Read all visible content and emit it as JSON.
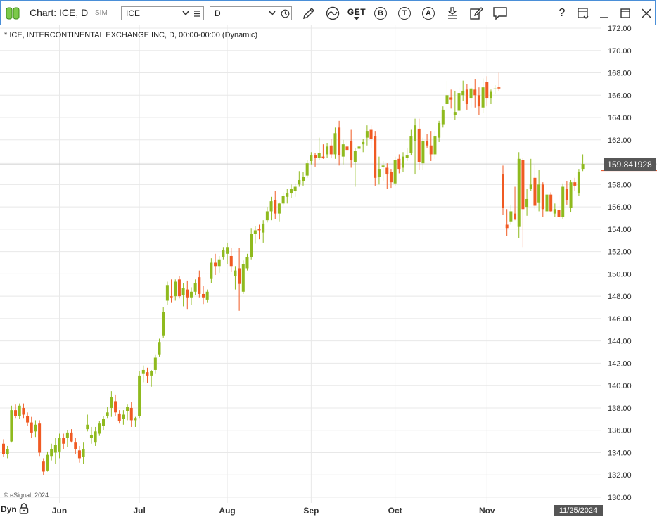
{
  "window": {
    "title": "Chart: ICE, D",
    "mode": "SIM",
    "symbol_value": "ICE",
    "interval_value": "D"
  },
  "toolbar": {
    "get_label": "GET",
    "b_label": "B",
    "t_label": "T",
    "a_label": "A",
    "help_label": "?"
  },
  "legend_text": "* ICE, INTERCONTINENTAL EXCHANGE INC, D, 00:00-00:00 (Dynamic)",
  "credit": "© eSignal, 2024",
  "dyn_label": "Dyn",
  "last_price": "159.841928",
  "current_date": "11/25/2024",
  "colors": {
    "up": "#8fba1e",
    "down": "#f05a23",
    "price_line": "#e65c35",
    "grid": "#e8e8e8"
  },
  "chart_data": {
    "type": "candlestick",
    "title": "",
    "ylim": [
      130,
      172
    ],
    "y_ticks": [
      "130.00",
      "132.00",
      "134.00",
      "136.00",
      "138.00",
      "140.00",
      "142.00",
      "144.00",
      "146.00",
      "148.00",
      "150.00",
      "152.00",
      "154.00",
      "156.00",
      "158.00",
      "160.00",
      "162.00",
      "164.00",
      "166.00",
      "168.00",
      "170.00",
      "172.00"
    ],
    "x_labels": [
      {
        "label": "Jun",
        "index": 14
      },
      {
        "label": "Jul",
        "index": 34
      },
      {
        "label": "Aug",
        "index": 56
      },
      {
        "label": "Sep",
        "index": 77
      },
      {
        "label": "Oct",
        "index": 98
      },
      {
        "label": "Nov",
        "index": 121
      }
    ],
    "last_value": 159.841928,
    "candles": [
      [
        134.8,
        135.2,
        133.6,
        133.9
      ],
      [
        133.9,
        134.6,
        133.5,
        134.3
      ],
      [
        135.0,
        138.2,
        134.9,
        137.8
      ],
      [
        137.8,
        138.3,
        137.1,
        137.3
      ],
      [
        137.3,
        138.4,
        137.0,
        138.2
      ],
      [
        138.0,
        138.4,
        137.1,
        137.4
      ],
      [
        137.3,
        137.6,
        136.4,
        136.7
      ],
      [
        136.7,
        137.2,
        135.3,
        135.8
      ],
      [
        135.9,
        136.9,
        135.4,
        136.5
      ],
      [
        136.6,
        136.9,
        133.7,
        134.0
      ],
      [
        133.2,
        133.5,
        132.0,
        132.3
      ],
      [
        132.4,
        134.1,
        132.3,
        133.8
      ],
      [
        133.7,
        134.8,
        133.3,
        134.3
      ],
      [
        134.0,
        135.3,
        133.0,
        134.7
      ],
      [
        134.1,
        135.7,
        133.5,
        135.3
      ],
      [
        135.3,
        135.7,
        134.3,
        134.8
      ],
      [
        135.3,
        136.0,
        134.5,
        135.8
      ],
      [
        135.8,
        136.1,
        134.9,
        135.0
      ],
      [
        134.9,
        135.3,
        133.9,
        134.3
      ],
      [
        134.2,
        134.6,
        133.1,
        133.5
      ],
      [
        133.6,
        134.9,
        133.0,
        134.3
      ],
      [
        136.1,
        137.4,
        135.9,
        136.5
      ],
      [
        135.3,
        136.3,
        134.8,
        135.6
      ],
      [
        134.9,
        136.3,
        134.6,
        135.9
      ],
      [
        135.7,
        136.8,
        135.5,
        136.6
      ],
      [
        136.4,
        137.3,
        136.0,
        137.0
      ],
      [
        137.3,
        138.1,
        137.1,
        137.6
      ],
      [
        138.0,
        139.5,
        137.2,
        139.0
      ],
      [
        138.6,
        139.2,
        137.3,
        137.6
      ],
      [
        137.5,
        137.8,
        136.6,
        136.8
      ],
      [
        137.0,
        137.8,
        136.5,
        137.4
      ],
      [
        137.7,
        138.3,
        136.9,
        138.1
      ],
      [
        138.0,
        138.5,
        136.3,
        136.9
      ],
      [
        136.9,
        137.2,
        136.3,
        137.1
      ],
      [
        137.3,
        141.3,
        137.1,
        140.9
      ],
      [
        141.1,
        141.8,
        140.3,
        141.4
      ],
      [
        141.2,
        141.6,
        140.2,
        140.9
      ],
      [
        140.9,
        141.4,
        139.9,
        141.3
      ],
      [
        141.4,
        142.8,
        141.1,
        142.5
      ],
      [
        142.8,
        144.2,
        142.6,
        143.9
      ],
      [
        144.5,
        147.0,
        144.3,
        146.6
      ],
      [
        147.6,
        149.3,
        147.2,
        149.0
      ],
      [
        148.0,
        149.5,
        147.4,
        147.9
      ],
      [
        148.0,
        149.5,
        147.6,
        149.3
      ],
      [
        149.5,
        149.8,
        147.8,
        148.0
      ],
      [
        148.1,
        149.2,
        147.1,
        148.7
      ],
      [
        148.6,
        149.4,
        146.8,
        147.9
      ],
      [
        147.9,
        148.8,
        147.2,
        148.4
      ],
      [
        148.4,
        149.5,
        148.1,
        149.2
      ],
      [
        149.7,
        150.3,
        147.9,
        148.2
      ],
      [
        148.2,
        148.9,
        147.3,
        147.9
      ],
      [
        147.7,
        148.6,
        147.4,
        148.4
      ],
      [
        149.6,
        151.4,
        149.2,
        151.0
      ],
      [
        151.0,
        151.8,
        149.9,
        150.7
      ],
      [
        150.7,
        151.6,
        150.1,
        151.3
      ],
      [
        151.5,
        152.4,
        151.3,
        152.1
      ],
      [
        151.8,
        152.8,
        150.9,
        152.4
      ],
      [
        151.6,
        152.3,
        150.2,
        150.7
      ],
      [
        149.8,
        150.7,
        148.6,
        150.3
      ],
      [
        150.5,
        152.3,
        146.7,
        149.1
      ],
      [
        148.4,
        151.2,
        148.2,
        150.9
      ],
      [
        150.5,
        151.8,
        150.3,
        151.5
      ],
      [
        151.5,
        154.1,
        151.3,
        153.6
      ],
      [
        153.6,
        154.3,
        152.7,
        153.9
      ],
      [
        154.0,
        154.4,
        153.1,
        153.9
      ],
      [
        153.7,
        154.8,
        152.8,
        154.5
      ],
      [
        154.8,
        156.0,
        154.6,
        155.6
      ],
      [
        155.6,
        156.9,
        154.8,
        156.5
      ],
      [
        156.6,
        157.4,
        154.9,
        155.4
      ],
      [
        155.4,
        156.4,
        154.7,
        156.3
      ],
      [
        156.3,
        157.3,
        156.1,
        157.0
      ],
      [
        156.9,
        157.6,
        156.3,
        157.2
      ],
      [
        157.2,
        158.0,
        156.8,
        157.6
      ],
      [
        157.4,
        158.1,
        156.9,
        157.8
      ],
      [
        158.0,
        159.2,
        157.8,
        158.4
      ],
      [
        158.3,
        159.1,
        157.9,
        158.7
      ],
      [
        158.8,
        160.2,
        158.6,
        159.9
      ],
      [
        160.1,
        160.9,
        159.8,
        160.6
      ],
      [
        160.6,
        160.8,
        159.6,
        160.4
      ],
      [
        160.4,
        162.2,
        160.2,
        160.8
      ],
      [
        160.5,
        161.6,
        160.3,
        160.4
      ],
      [
        160.7,
        161.7,
        160.4,
        161.4
      ],
      [
        161.5,
        162.1,
        160.4,
        160.7
      ],
      [
        160.7,
        163.1,
        160.3,
        162.6
      ],
      [
        163.1,
        163.7,
        159.7,
        160.6
      ],
      [
        160.5,
        162.0,
        159.8,
        161.6
      ],
      [
        161.4,
        161.9,
        160.1,
        161.1
      ],
      [
        161.9,
        162.9,
        159.5,
        160.2
      ],
      [
        160.0,
        161.3,
        157.8,
        161.0
      ],
      [
        161.2,
        161.5,
        160.0,
        161.4
      ],
      [
        161.6,
        162.1,
        160.9,
        161.8
      ],
      [
        162.2,
        163.3,
        161.5,
        162.8
      ],
      [
        162.9,
        163.3,
        161.3,
        162.1
      ],
      [
        162.3,
        162.8,
        157.9,
        158.6
      ],
      [
        158.7,
        160.5,
        158.0,
        159.4
      ],
      [
        159.6,
        160.1,
        158.3,
        159.7
      ],
      [
        159.5,
        159.9,
        157.6,
        158.9
      ],
      [
        159.1,
        159.4,
        157.7,
        158.2
      ],
      [
        158.1,
        160.5,
        157.9,
        160.2
      ],
      [
        160.3,
        160.7,
        159.0,
        159.4
      ],
      [
        159.5,
        160.9,
        159.1,
        160.5
      ],
      [
        160.4,
        161.3,
        160.1,
        160.6
      ],
      [
        160.8,
        162.9,
        160.6,
        162.3
      ],
      [
        161.9,
        163.9,
        158.9,
        163.3
      ],
      [
        163.0,
        163.9,
        159.3,
        160.0
      ],
      [
        159.9,
        162.2,
        159.3,
        161.9
      ],
      [
        161.9,
        162.5,
        161.3,
        161.5
      ],
      [
        161.5,
        162.8,
        160.1,
        160.7
      ],
      [
        160.7,
        162.8,
        160.3,
        162.3
      ],
      [
        162.2,
        163.7,
        161.8,
        163.5
      ],
      [
        163.4,
        165.0,
        163.1,
        164.7
      ],
      [
        165.2,
        167.3,
        164.7,
        166.0
      ],
      [
        165.8,
        166.5,
        164.8,
        165.6
      ],
      [
        164.2,
        166.4,
        163.8,
        164.5
      ],
      [
        164.6,
        166.7,
        164.2,
        166.2
      ],
      [
        166.0,
        167.3,
        165.5,
        166.4
      ],
      [
        166.5,
        167.0,
        164.7,
        165.2
      ],
      [
        165.7,
        166.7,
        164.9,
        166.6
      ],
      [
        166.5,
        167.4,
        164.9,
        166.0
      ],
      [
        166.0,
        166.7,
        164.2,
        165.0
      ],
      [
        164.9,
        167.5,
        164.4,
        166.7
      ],
      [
        167.2,
        167.7,
        165.0,
        165.7
      ],
      [
        165.7,
        166.5,
        165.2,
        166.3
      ],
      [
        166.6,
        166.9,
        166.1,
        166.6
      ],
      [
        166.7,
        168.0,
        166.4,
        166.6
      ],
      [
        158.9,
        159.7,
        155.3,
        155.9
      ],
      [
        154.4,
        155.8,
        153.4,
        154.1
      ],
      [
        154.7,
        156.2,
        154.4,
        155.6
      ],
      [
        155.4,
        157.8,
        154.8,
        154.9
      ],
      [
        154.2,
        160.9,
        153.2,
        160.3
      ],
      [
        160.2,
        160.4,
        152.4,
        155.8
      ],
      [
        156.0,
        157.6,
        155.2,
        156.7
      ],
      [
        157.6,
        160.3,
        157.4,
        158.0
      ],
      [
        158.6,
        159.8,
        155.8,
        156.1
      ],
      [
        156.4,
        159.3,
        155.6,
        158.0
      ],
      [
        158.0,
        158.2,
        155.1,
        155.8
      ],
      [
        155.6,
        158.1,
        155.2,
        157.1
      ],
      [
        157.1,
        157.3,
        155.5,
        155.6
      ],
      [
        155.4,
        156.3,
        155.1,
        155.8
      ],
      [
        155.7,
        157.1,
        154.9,
        155.1
      ],
      [
        155.1,
        158.1,
        154.9,
        157.8
      ],
      [
        157.6,
        158.3,
        156.2,
        156.6
      ],
      [
        155.9,
        158.4,
        155.5,
        158.2
      ],
      [
        158.2,
        158.6,
        157.4,
        157.9
      ],
      [
        157.2,
        159.4,
        157.0,
        159.1
      ],
      [
        159.4,
        160.7,
        159.2,
        159.84
      ]
    ]
  }
}
